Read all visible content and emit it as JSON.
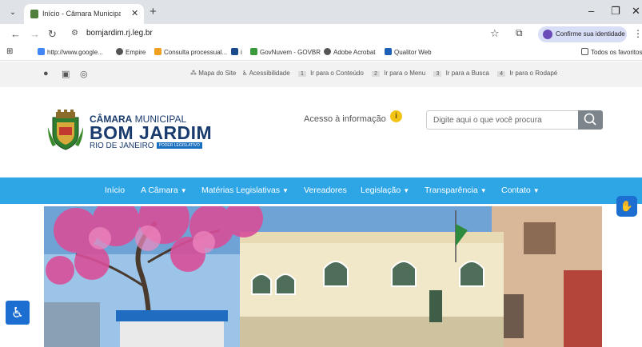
{
  "browser": {
    "tab_title": "Início - Câmara Municipal de B...",
    "url": "bomjardim.rj.leg.br",
    "identity_button": "Confirme sua identidade",
    "bookmarks": [
      "http://www.google...",
      "Empire",
      "Consulta processual...",
      "i",
      "GovNuvem - GOVBR",
      "Adobe Acrobat",
      "Qualitor Web"
    ],
    "all_bookmarks": "Todos os favoritos"
  },
  "topbar": {
    "links": [
      {
        "label": "Mapa do Site"
      },
      {
        "label": "Acessibilidade",
        "key": "1"
      },
      {
        "label": "Ir para o Conteúdo",
        "key": "2"
      },
      {
        "label": "Ir para o Menu",
        "key": "3"
      },
      {
        "label": "Ir para a Busca",
        "key": "4"
      },
      {
        "label": "Ir para o Rodapé"
      }
    ]
  },
  "logo": {
    "line1_bold": "CÂMARA",
    "line1_rest": " MUNICIPAL",
    "line2": "BOM JARDIM",
    "line3": "RIO DE JANEIRO",
    "badge": "PODER LEGISLATIVO"
  },
  "header": {
    "acesso_label": "Acesso à informação",
    "search_placeholder": "Digite aqui o que você procura"
  },
  "nav": {
    "items": [
      {
        "label": "Início"
      },
      {
        "label": "A Câmara"
      },
      {
        "label": "Matérias Legislativas"
      },
      {
        "label": "Vereadores"
      },
      {
        "label": "Legislação"
      },
      {
        "label": "Transparência"
      },
      {
        "label": "Contato"
      }
    ]
  },
  "colors": {
    "nav_bg": "#2ea6e6",
    "brand_blue": "#1a3b6e",
    "accessibility_blue": "#1c6fd1"
  }
}
